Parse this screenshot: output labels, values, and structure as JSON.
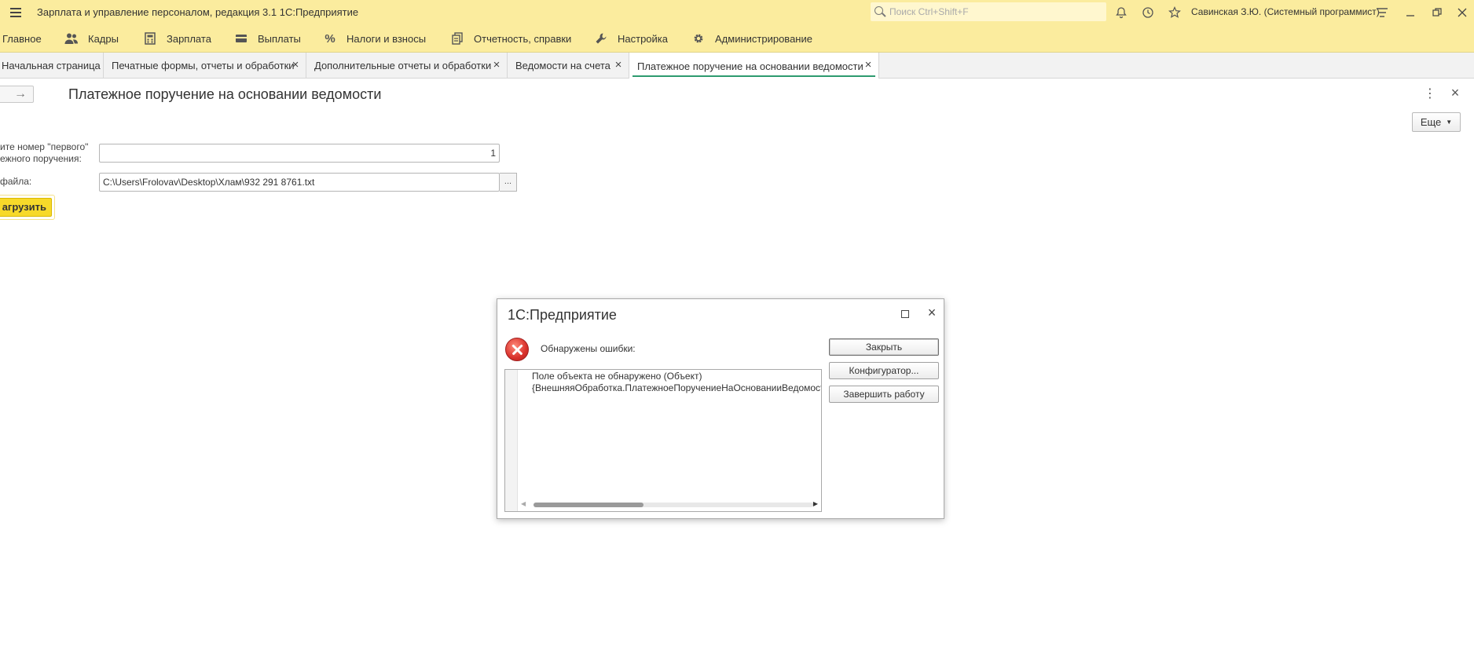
{
  "app": {
    "title": "Зарплата и управление персоналом, редакция 3.1 1С:Предприятие",
    "search_placeholder": "Поиск Ctrl+Shift+F",
    "user": "Савинская З.Ю. (Системный программист)",
    "accent_color": "#fbec9e"
  },
  "sections": [
    {
      "label": "Главное",
      "icon": "menu-icon"
    },
    {
      "label": "Кадры",
      "icon": "people-icon"
    },
    {
      "label": "Зарплата",
      "icon": "calculator-icon"
    },
    {
      "label": "Выплаты",
      "icon": "wallet-icon"
    },
    {
      "label": "Налоги и взносы",
      "icon": "percent-icon"
    },
    {
      "label": "Отчетность, справки",
      "icon": "reports-icon"
    },
    {
      "label": "Настройка",
      "icon": "wrench-icon"
    },
    {
      "label": "Администрирование",
      "icon": "gear-icon"
    }
  ],
  "tabs": [
    {
      "label": "Начальная страница"
    },
    {
      "label": "Печатные формы, отчеты и обработки"
    },
    {
      "label": "Дополнительные отчеты и обработки"
    },
    {
      "label": "Ведомости на счета"
    },
    {
      "label": "Платежное поручение на основании ведомости"
    }
  ],
  "form": {
    "title": "Платежное поручение на основании ведомости",
    "more_label": "Еще",
    "first_number_label_line1": "ите номер \"первого\"",
    "first_number_label_line2": "ежного поручения:",
    "first_number_value": "1",
    "file_label": "файла:",
    "file_value": "C:\\Users\\Frolovav\\Desktop\\Хлам\\932 291 8761.txt",
    "ellipsis": "...",
    "load_button": "агрузить"
  },
  "dialog": {
    "title": "1С:Предприятие",
    "message": "Обнаружены ошибки:",
    "error_line1": "Поле объекта не обнаружено (Объект)",
    "error_line2": "{ВнешняяОбработка.ПлатежноеПоручениеНаОснованииВедомости",
    "close_button": "Закрыть",
    "configurator_button": "Конфигуратор...",
    "exit_button": "Завершить работу"
  }
}
